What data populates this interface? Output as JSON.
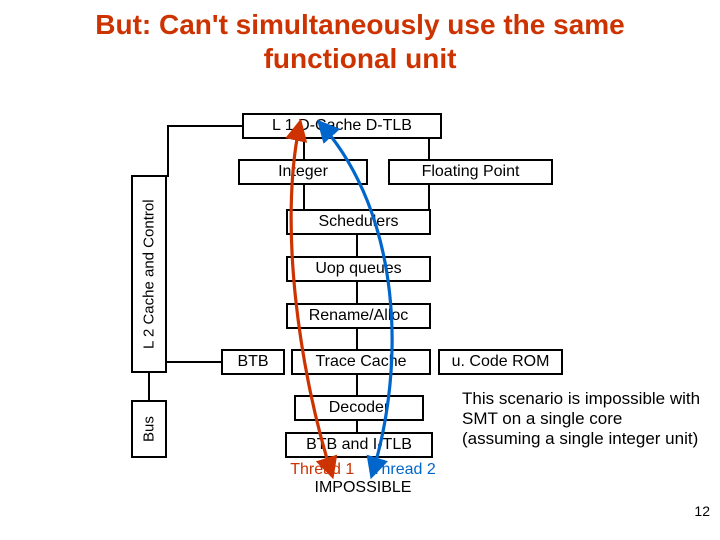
{
  "title": "But: Can't simultaneously use the same functional unit",
  "boxes": {
    "l2": "L 2 Cache and Control",
    "bus": "Bus",
    "l1": "L 1 D-Cache D-TLB",
    "integer": "Integer",
    "fp": "Floating Point",
    "schedulers": "Schedulers",
    "uop": "Uop queues",
    "rename": "Rename/Alloc",
    "btb": "BTB",
    "trace": "Trace Cache",
    "ucode": "u. Code ROM",
    "decoder": "Decoder",
    "btb_itlb": "BTB and I-TLB"
  },
  "threads": {
    "t1": "Thread 1",
    "t2": "Thread 2",
    "impossible": "IMPOSSIBLE"
  },
  "note": "This scenario is impossible with SMT on a single core (assuming a single integer unit)",
  "slide_number": "12",
  "colors": {
    "t1": "#cc3300",
    "t2": "#0066cc"
  }
}
